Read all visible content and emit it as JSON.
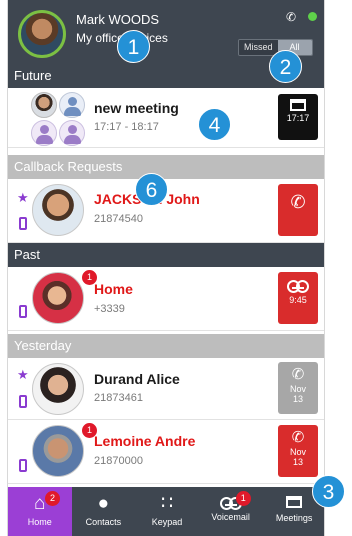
{
  "header": {
    "user_name": "Mark WOODS",
    "user_status": "My office devices",
    "filter_missed": "Missed",
    "filter_all": "All"
  },
  "sections": {
    "future": "Future",
    "callback": "Callback Requests",
    "past": "Past",
    "yesterday": "Yesterday"
  },
  "rows": [
    {
      "title": "new meeting",
      "subtitle": "17:17 - 18:17",
      "action_label": "17:17"
    },
    {
      "title": "JACKSON John",
      "subtitle": "21874540"
    },
    {
      "title": "Home",
      "subtitle": "+3339",
      "badge": "1",
      "action_label": "9:45"
    },
    {
      "title": "Durand Alice",
      "subtitle": "21873461",
      "action_month": "Nov",
      "action_day": "13"
    },
    {
      "title": "Lemoine Andre",
      "subtitle": "21870000",
      "badge": "1",
      "action_month": "Nov",
      "action_day": "13"
    }
  ],
  "tabs": [
    {
      "label": "Home",
      "badge": "2"
    },
    {
      "label": "Contacts"
    },
    {
      "label": "Keypad"
    },
    {
      "label": "Voicemail",
      "badge": "1"
    },
    {
      "label": "Meetings"
    }
  ],
  "markers": [
    "1",
    "2",
    "3",
    "4",
    "6"
  ],
  "colors": {
    "header_bg": "#3e4650",
    "accent_purple": "#9b3fd5",
    "call_red": "#d92c2c",
    "marker_blue": "#2491d6",
    "presence_green": "#5fd04a"
  }
}
